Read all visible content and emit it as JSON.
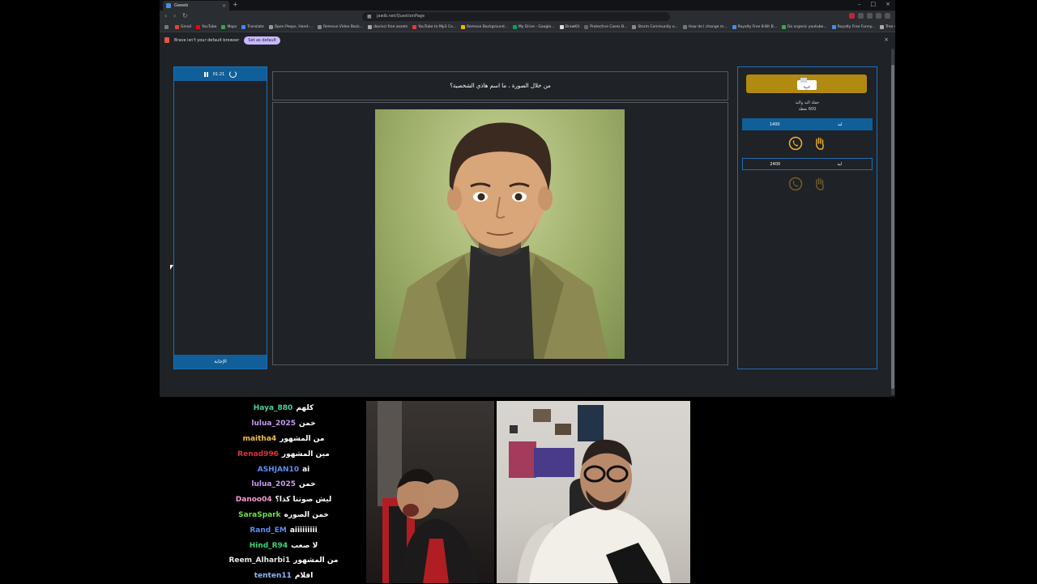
{
  "browser": {
    "tab_title": "Gweeb",
    "url": "jawib.net/QuestionPage",
    "bookmarks": [
      "Gmail",
      "YouTube",
      "Maps",
      "Translate",
      "Open Peeps, Hand-...",
      "Remove Video Back...",
      "davinci free assets",
      "YouTube to Mp3 Co...",
      "Remove Background...",
      "My Drive - Google...",
      "DrawKit",
      "Protective Cases B...",
      "Storm Community o...",
      "How do I change m...",
      "Royalty Free 8-Bit B...",
      "Do organic youtube...",
      "Royalty Free Funny...",
      "Tree view React com..."
    ],
    "bookmark_colors": [
      "#ea4335",
      "#ff0000",
      "#34a853",
      "#4285f4",
      "#999999",
      "#888888",
      "#aaaaaa",
      "#e53935",
      "#f4b400",
      "#0f9d58",
      "#dddddd",
      "#666666",
      "#888888",
      "#777777",
      "#4a8ce0",
      "#34a853",
      "#4a8ce0",
      "#aaaaaa"
    ],
    "infobar_text": "Brave isn't your default browser",
    "set_default_label": "Set as default"
  },
  "game": {
    "timer": "01:21",
    "answer_label": "الإجابة",
    "question": "من خلال الصورة ، ما اسم هاذي الشخصية؟",
    "team_info_line1": "حفلة اليد واليد",
    "team_info_line2": "600 نقطة",
    "team1": {
      "name": "ليد",
      "score": "1400"
    },
    "team2": {
      "name": "ليد",
      "score": "2400"
    },
    "accent_color": "#105f98",
    "gold_color": "#b18a12"
  },
  "chat": [
    {
      "user": "Haya_880",
      "msg": "كلهم",
      "color": "#4fd19a"
    },
    {
      "user": "lulua_2025",
      "msg": "خمن",
      "color": "#c89bf0"
    },
    {
      "user": "maitha4",
      "msg": "من المشهور",
      "color": "#f3c04a"
    },
    {
      "user": "Renad996",
      "msg": "مين المشهور",
      "color": "#e0323c"
    },
    {
      "user": "ASHJAN10",
      "msg": "ai",
      "color": "#5b8df0"
    },
    {
      "user": "lulua_2025",
      "msg": "خمن",
      "color": "#c89bf0"
    },
    {
      "user": "Danoo04",
      "msg": "ليش صوتنا كذا؟",
      "color": "#f59bd0"
    },
    {
      "user": "SaraSpark",
      "msg": "خمن الصوره",
      "color": "#6fe04a"
    },
    {
      "user": "Rand_EM",
      "msg": "aiiiiiiiii",
      "color": "#5b8df0"
    },
    {
      "user": "Hind_R94",
      "msg": "لا صعب",
      "color": "#3bd67a"
    },
    {
      "user": "Reem_Alharbi1",
      "msg": "من المشهور",
      "color": "#e6e6e6"
    },
    {
      "user": "tenten11",
      "msg": "افلام",
      "color": "#8fb3ff"
    }
  ]
}
